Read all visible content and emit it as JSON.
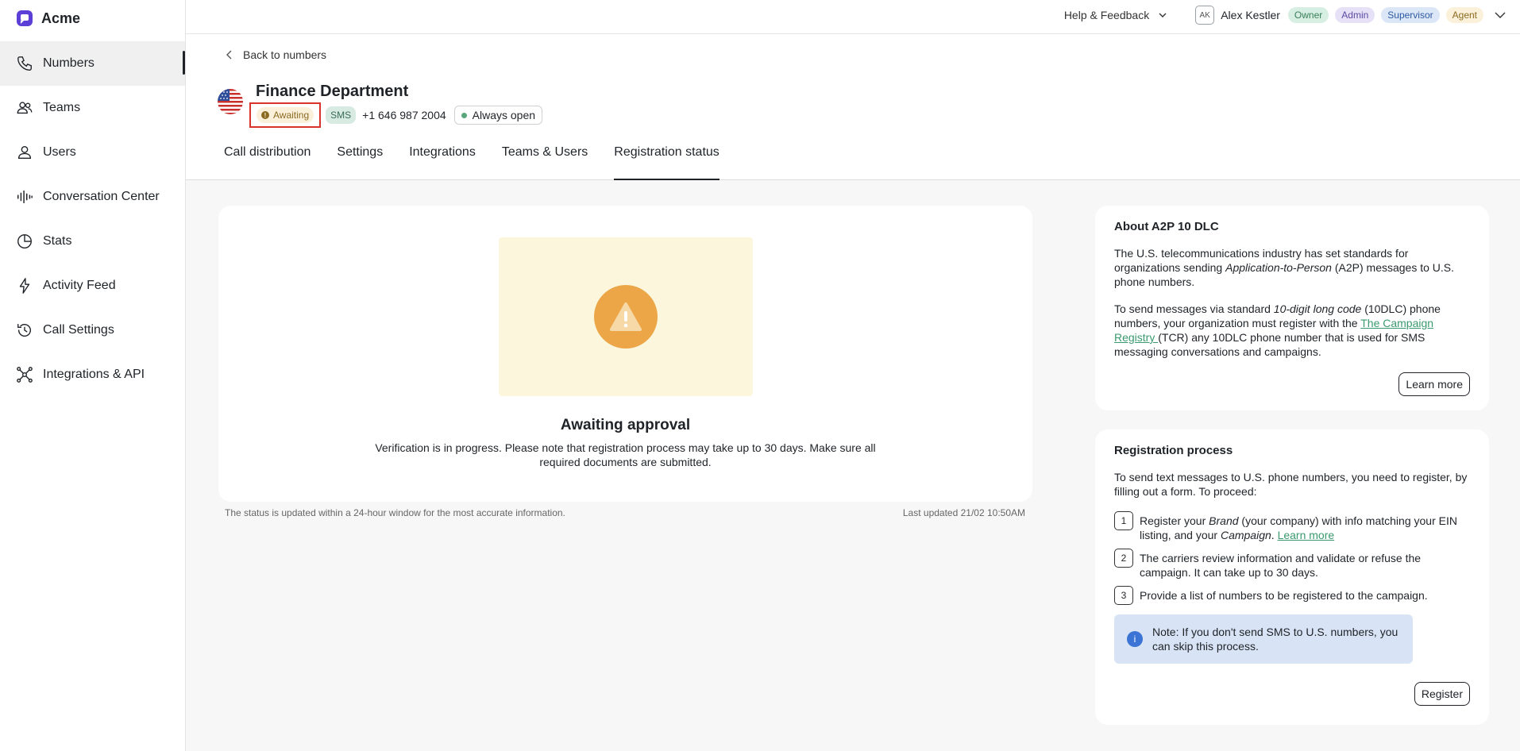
{
  "app": {
    "name": "Acme"
  },
  "sidebar": {
    "items": [
      {
        "label": "Numbers",
        "icon": "phone-icon"
      },
      {
        "label": "Teams",
        "icon": "teams-icon"
      },
      {
        "label": "Users",
        "icon": "user-icon"
      },
      {
        "label": "Conversation Center",
        "icon": "audio-bars-icon"
      },
      {
        "label": "Stats",
        "icon": "pie-chart-icon"
      },
      {
        "label": "Activity Feed",
        "icon": "lightning-icon"
      },
      {
        "label": "Call Settings",
        "icon": "history-icon"
      },
      {
        "label": "Integrations & API",
        "icon": "network-icon"
      }
    ],
    "active": "Numbers"
  },
  "topbar": {
    "help_label": "Help & Feedback",
    "user_initials": "AK",
    "user_name": "Alex Kestler",
    "roles": [
      "Owner",
      "Admin",
      "Supervisor",
      "Agent"
    ]
  },
  "header": {
    "back_label": "Back to numbers",
    "title": "Finance Department",
    "status_badge": "Awaiting",
    "channel_badge": "SMS",
    "phone": "+1 646 987 2004",
    "hours_badge": "Always open",
    "tabs": [
      "Call distribution",
      "Settings",
      "Integrations",
      "Teams & Users",
      "Registration status"
    ],
    "active_tab": "Registration status"
  },
  "status": {
    "title": "Awaiting approval",
    "description": "Verification is in progress. Please note that registration process may take up to 30 days. Make sure all required documents are submitted.",
    "footnote": "The status is updated within a 24-hour window for the most accurate information.",
    "last_updated": "Last updated 21/02 10:50AM"
  },
  "about": {
    "title": "About A2P 10 DLC",
    "p1_start": "The U.S. telecommunications industry has set standards for organizations sending ",
    "p1_em": "Application-to-Person",
    "p1_end": " (A2P) messages to U.S. phone numbers.",
    "p2_start": "To send messages via standard ",
    "p2_em": "10-digit long code",
    "p2_mid": " (10DLC) phone numbers, your organization must register with the ",
    "p2_link": "The Campaign Registry ",
    "p2_end": "(TCR) any 10DLC phone number that is used for SMS messaging conversations and campaigns.",
    "learn_more_button": "Learn more"
  },
  "registration": {
    "title": "Registration process",
    "intro": "To send text messages to U.S. phone numbers, you need to register, by filling out a form. To proceed:",
    "step1_num": "1",
    "step1_a": "Register your ",
    "step1_em1": "Brand",
    "step1_b": " (your company) with info matching your EIN listing, and your ",
    "step1_em2": "Campaign",
    "step1_c": ". ",
    "step1_link": "Learn more",
    "step2_num": "2",
    "step2": "The carriers review information and validate or refuse the campaign. It can take up to 30 days.",
    "step3_num": "3",
    "step3": "Provide a list of numbers to be registered to the campaign.",
    "note": "Note: If you don't send SMS to U.S. numbers, you can skip this process.",
    "register_button": "Register"
  },
  "colors": {
    "awaiting_bg": "#fbf1da",
    "awaiting_text": "#8a6a21",
    "highlight_border": "#d9342b",
    "warning": "#eca648",
    "link": "#3a9a6e",
    "note_bg": "#d8e4f5"
  }
}
